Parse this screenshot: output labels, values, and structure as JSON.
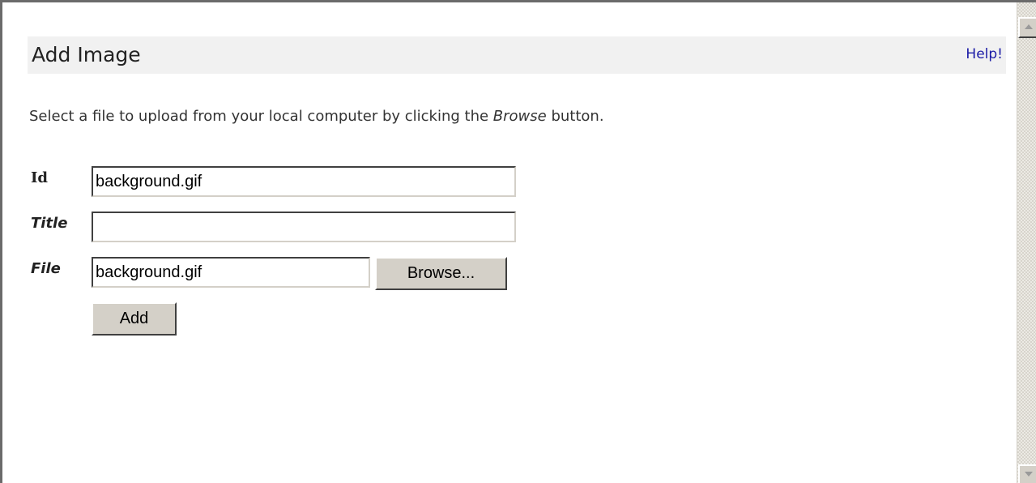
{
  "header": {
    "title": "Add Image",
    "help_label": "Help!"
  },
  "instructions": {
    "before": "Select a file to upload from your local computer by clicking the ",
    "emphasis": "Browse",
    "after": " button."
  },
  "form": {
    "id_label": "Id",
    "id_value": "background.gif",
    "title_label": "Title",
    "title_value": "",
    "file_label": "File",
    "file_value": "background.gif",
    "browse_label": "Browse...",
    "add_label": "Add"
  },
  "icons": {
    "scroll_up": "scroll-up-arrow-icon",
    "scroll_down": "scroll-down-arrow-icon"
  },
  "colors": {
    "help_link": "#1a1aa6",
    "title_bar_bg": "#f1f1f1",
    "button_face": "#d4d0c8"
  }
}
